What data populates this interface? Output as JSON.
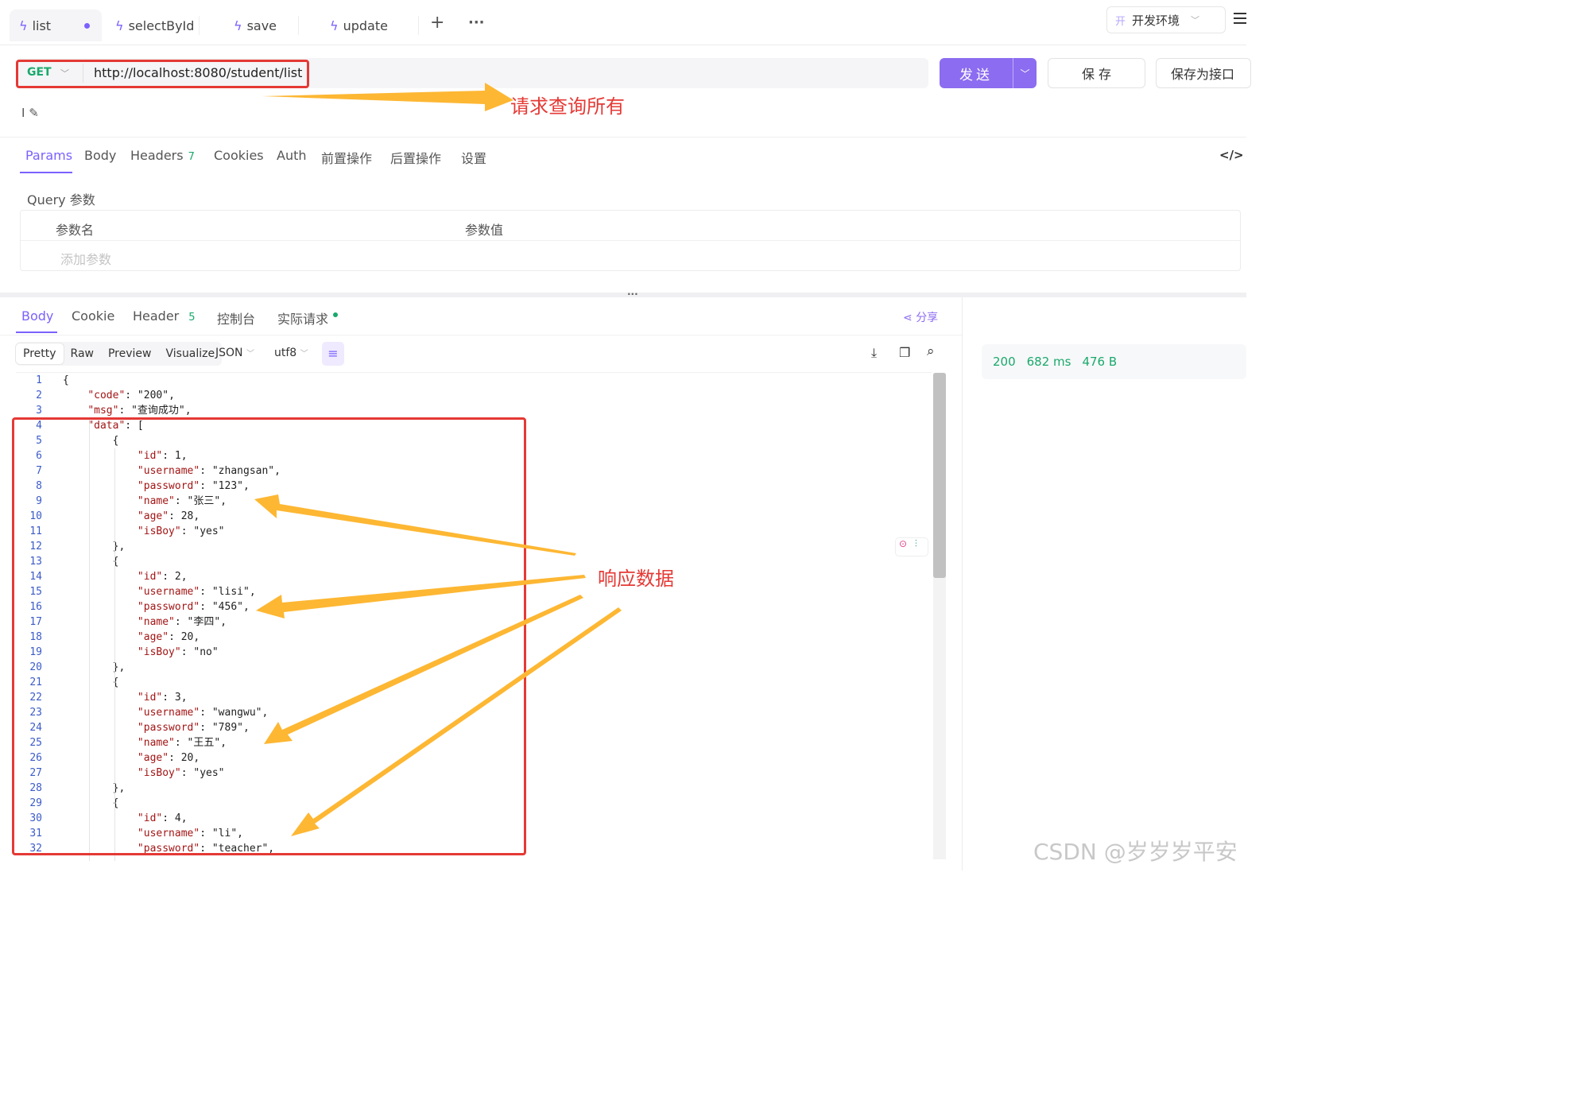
{
  "tabs": [
    {
      "label": "list",
      "active": true,
      "unsaved": true
    },
    {
      "label": "selectById"
    },
    {
      "label": "save"
    },
    {
      "label": "update"
    }
  ],
  "tabbar": {
    "add": "+",
    "more": "···"
  },
  "env": {
    "icon_text": "开",
    "label": "开发环境"
  },
  "request": {
    "method": "GET",
    "url": "http://localhost:8080/student/list",
    "send": "发送",
    "save": "保 存",
    "save_as": "保存为接口"
  },
  "annotations": {
    "request": "请求查询所有",
    "response": "响应数据"
  },
  "param_tabs": [
    {
      "label": "Params",
      "active": true
    },
    {
      "label": "Body"
    },
    {
      "label": "Headers",
      "badge": "7"
    },
    {
      "label": "Cookies"
    },
    {
      "label": "Auth"
    },
    {
      "label": "前置操作"
    },
    {
      "label": "后置操作"
    },
    {
      "label": "设置"
    }
  ],
  "query": {
    "title": "Query 参数",
    "col_name": "参数名",
    "col_value": "参数值",
    "add_placeholder": "添加参数"
  },
  "response_tabs": [
    {
      "label": "Body",
      "active": true
    },
    {
      "label": "Cookie"
    },
    {
      "label": "Header",
      "badge": "5"
    },
    {
      "label": "控制台"
    },
    {
      "label": "实际请求",
      "dot": true
    }
  ],
  "share": "分享",
  "view_modes": [
    "Pretty",
    "Raw",
    "Preview",
    "Visualize"
  ],
  "format": "JSON",
  "encoding": "utf8",
  "status": {
    "code": "200",
    "time": "682 ms",
    "size": "476 B"
  },
  "code_lines": [
    "{",
    "    \"code\": \"200\",",
    "    \"msg\": \"查询成功\",",
    "    \"data\": [",
    "        {",
    "            \"id\": 1,",
    "            \"username\": \"zhangsan\",",
    "            \"password\": \"123\",",
    "            \"name\": \"张三\",",
    "            \"age\": 28,",
    "            \"isBoy\": \"yes\"",
    "        },",
    "        {",
    "            \"id\": 2,",
    "            \"username\": \"lisi\",",
    "            \"password\": \"456\",",
    "            \"name\": \"李四\",",
    "            \"age\": 20,",
    "            \"isBoy\": \"no\"",
    "        },",
    "        {",
    "            \"id\": 3,",
    "            \"username\": \"wangwu\",",
    "            \"password\": \"789\",",
    "            \"name\": \"王五\",",
    "            \"age\": 20,",
    "            \"isBoy\": \"yes\"",
    "        },",
    "        {",
    "            \"id\": 4,",
    "            \"username\": \"li\",",
    "            \"password\": \"teacher\","
  ],
  "watermark": "CSDN @岁岁岁平安"
}
